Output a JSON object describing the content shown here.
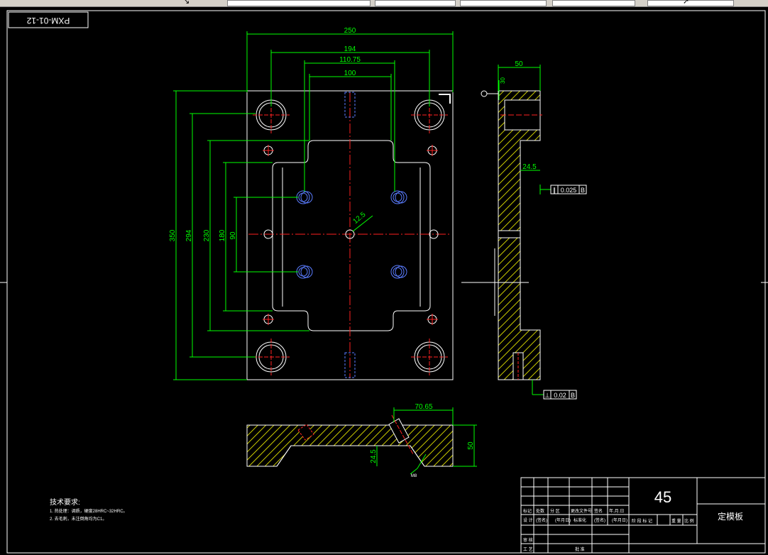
{
  "drawing": {
    "code": "PXM-01-12",
    "hole_label": "12.5",
    "dims_horizontal": [
      "250",
      "194",
      "110.75",
      "100"
    ],
    "dims_vertical": [
      "350",
      "294",
      "230",
      "180",
      "90"
    ],
    "side_view": {
      "top_width": "50",
      "top_small": "30",
      "depth": "24.5",
      "parallel_tol": "0.025",
      "parallel_datum": "B",
      "perp_tol": "0.02",
      "perp_datum": "B"
    },
    "section_view": {
      "width_dim": "70.65",
      "height_dim": "50",
      "depth_dim": "24.5",
      "leader": "M8"
    },
    "notes": {
      "title": "技术要求:",
      "lines": [
        "1. 热处理：调质，硬度28HRC~32HRC。",
        "2. 去毛刺，未注倒角均为C1。"
      ]
    },
    "title_block": {
      "material": "45",
      "part_name": "定模板",
      "row_labels": [
        "标记",
        "处数",
        "分 区",
        "更改文件号",
        "签名",
        "年.月.日"
      ],
      "row2": [
        "设 计",
        "(签名)",
        "(年月日)",
        "标准化",
        "(签名)",
        "(年月日)"
      ],
      "row3": [
        "审 核"
      ],
      "row4": [
        "工 艺",
        "批 准"
      ],
      "stage_labels": [
        "阶 段 标 记",
        "重 量",
        "比 例"
      ]
    }
  }
}
